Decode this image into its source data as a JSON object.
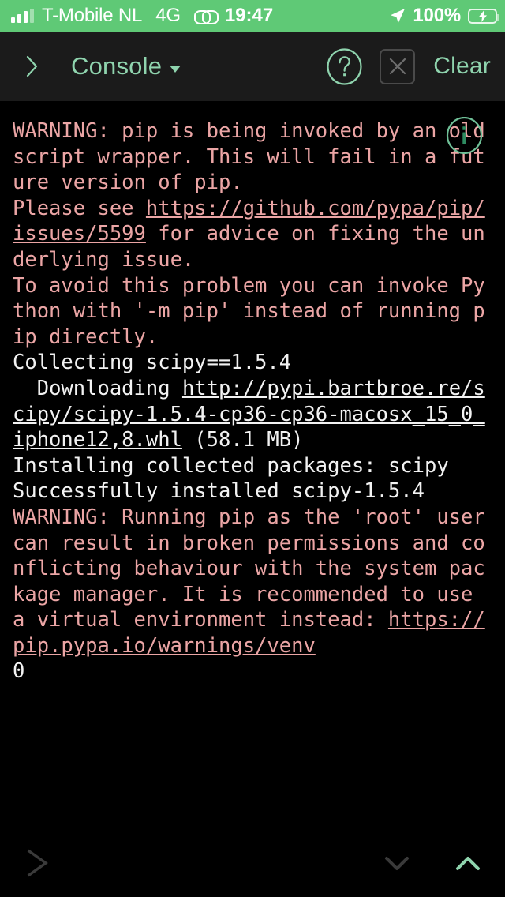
{
  "status_bar": {
    "signal_icon": "signal-bars-icon",
    "carrier": "T-Mobile NL",
    "network": "4G",
    "link_icon": "chain-link-icon",
    "time": "19:47",
    "location_icon": "location-arrow-icon",
    "battery_percent": "100%",
    "battery_icon": "battery-charging-icon",
    "background_color": "#5FC976",
    "text_color": "#FFFFFF"
  },
  "header": {
    "back_icon": "chevron-right-icon",
    "title": "Console",
    "dropdown_icon": "caret-down-icon",
    "help_icon": "question-mark-circle-icon",
    "close_icon": "x-square-icon",
    "clear_label": "Clear",
    "accent_color": "#8FD4AE",
    "background_color": "#1B1B1B"
  },
  "console": {
    "background_color": "#000000",
    "warning_color": "#EBA5A5",
    "output_color": "#F2F2F2",
    "info_badge_icon": "info-circle-icon",
    "lines": [
      {
        "style": "warn",
        "text": "WARNING: pip is being invoked by an old script wrapper. This will fail in a future version of pip.\nPlease see "
      },
      {
        "style": "warn",
        "link": true,
        "text": "https://github.com/pypa/pip/issues/5599"
      },
      {
        "style": "warn",
        "text": " for advice on fixing the underlying issue.\nTo avoid this problem you can invoke Python with '-m pip' instead of running pip directly.\n"
      },
      {
        "style": "out",
        "text": "Collecting scipy==1.5.4\n  Downloading "
      },
      {
        "style": "out",
        "link": true,
        "text": "http://pypi.bartbroe.re/scipy/scipy-1.5.4-cp36-cp36-macosx_15_0_iphone12,8.whl"
      },
      {
        "style": "out",
        "text": " (58.1 MB)\nInstalling collected packages: scipy\nSuccessfully installed scipy-1.5.4\n"
      },
      {
        "style": "warn",
        "text": "WARNING: Running pip as the 'root' user can result in broken permissions and conflicting behaviour with the system package manager. It is recommended to use a virtual environment instead: "
      },
      {
        "style": "warn",
        "link": true,
        "text": "https://pip.pypa.io/warnings/venv"
      },
      {
        "style": "out",
        "text": "\n0"
      }
    ]
  },
  "bottom_bar": {
    "prompt_icon": "chevron-right-prompt-icon",
    "scroll_down_icon": "chevron-down-icon",
    "scroll_up_icon": "chevron-up-icon",
    "inactive_color": "#3A3A3A",
    "active_color": "#8FD4AE"
  }
}
